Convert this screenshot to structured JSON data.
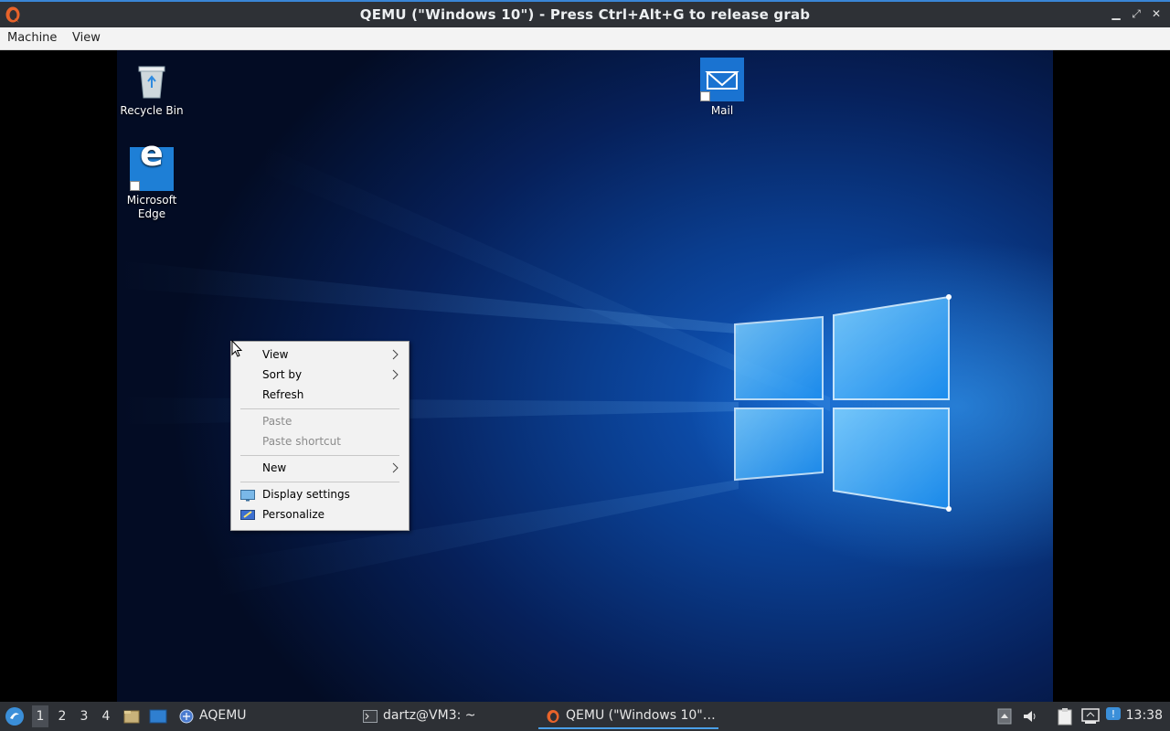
{
  "window": {
    "title": "QEMU (\"Windows 10\") - Press Ctrl+Alt+G to release grab",
    "buttons": [
      "minimize",
      "maximize",
      "close"
    ]
  },
  "menubar": {
    "items": [
      "Machine",
      "View"
    ]
  },
  "desktop": {
    "icons": [
      {
        "label": "Recycle Bin",
        "icon": "recycle-bin-icon"
      },
      {
        "label": "Microsoft Edge",
        "icon": "edge-icon"
      },
      {
        "label": "Mail",
        "icon": "mail-icon"
      }
    ]
  },
  "context_menu": {
    "items": [
      {
        "label": "View",
        "submenu": true,
        "enabled": true
      },
      {
        "label": "Sort by",
        "submenu": true,
        "enabled": true
      },
      {
        "label": "Refresh",
        "submenu": false,
        "enabled": true
      },
      {
        "label": "Paste",
        "submenu": false,
        "enabled": false
      },
      {
        "label": "Paste shortcut",
        "submenu": false,
        "enabled": false
      },
      {
        "label": "New",
        "submenu": true,
        "enabled": true
      },
      {
        "label": "Display settings",
        "submenu": false,
        "enabled": true,
        "icon": "display-icon"
      },
      {
        "label": "Personalize",
        "submenu": false,
        "enabled": true,
        "icon": "personalize-icon"
      }
    ]
  },
  "taskbar": {
    "workspaces": [
      "1",
      "2",
      "3",
      "4"
    ],
    "active_workspace": "1",
    "tasks": [
      {
        "label": "AQEMU",
        "icon": "aqemu-icon"
      },
      {
        "label": "dartz@VM3: ~",
        "icon": "terminal-icon"
      },
      {
        "label": "QEMU (\"Windows 10\"…",
        "icon": "qemu-icon",
        "active": true
      }
    ],
    "clock": "13:38"
  },
  "colors": {
    "titlebar": "#2e3136",
    "accent": "#3a86d6",
    "wallpaper_blue": "#0f5bc4",
    "menu_bg": "#f2f2f2",
    "taskbar": "#2d3035"
  }
}
